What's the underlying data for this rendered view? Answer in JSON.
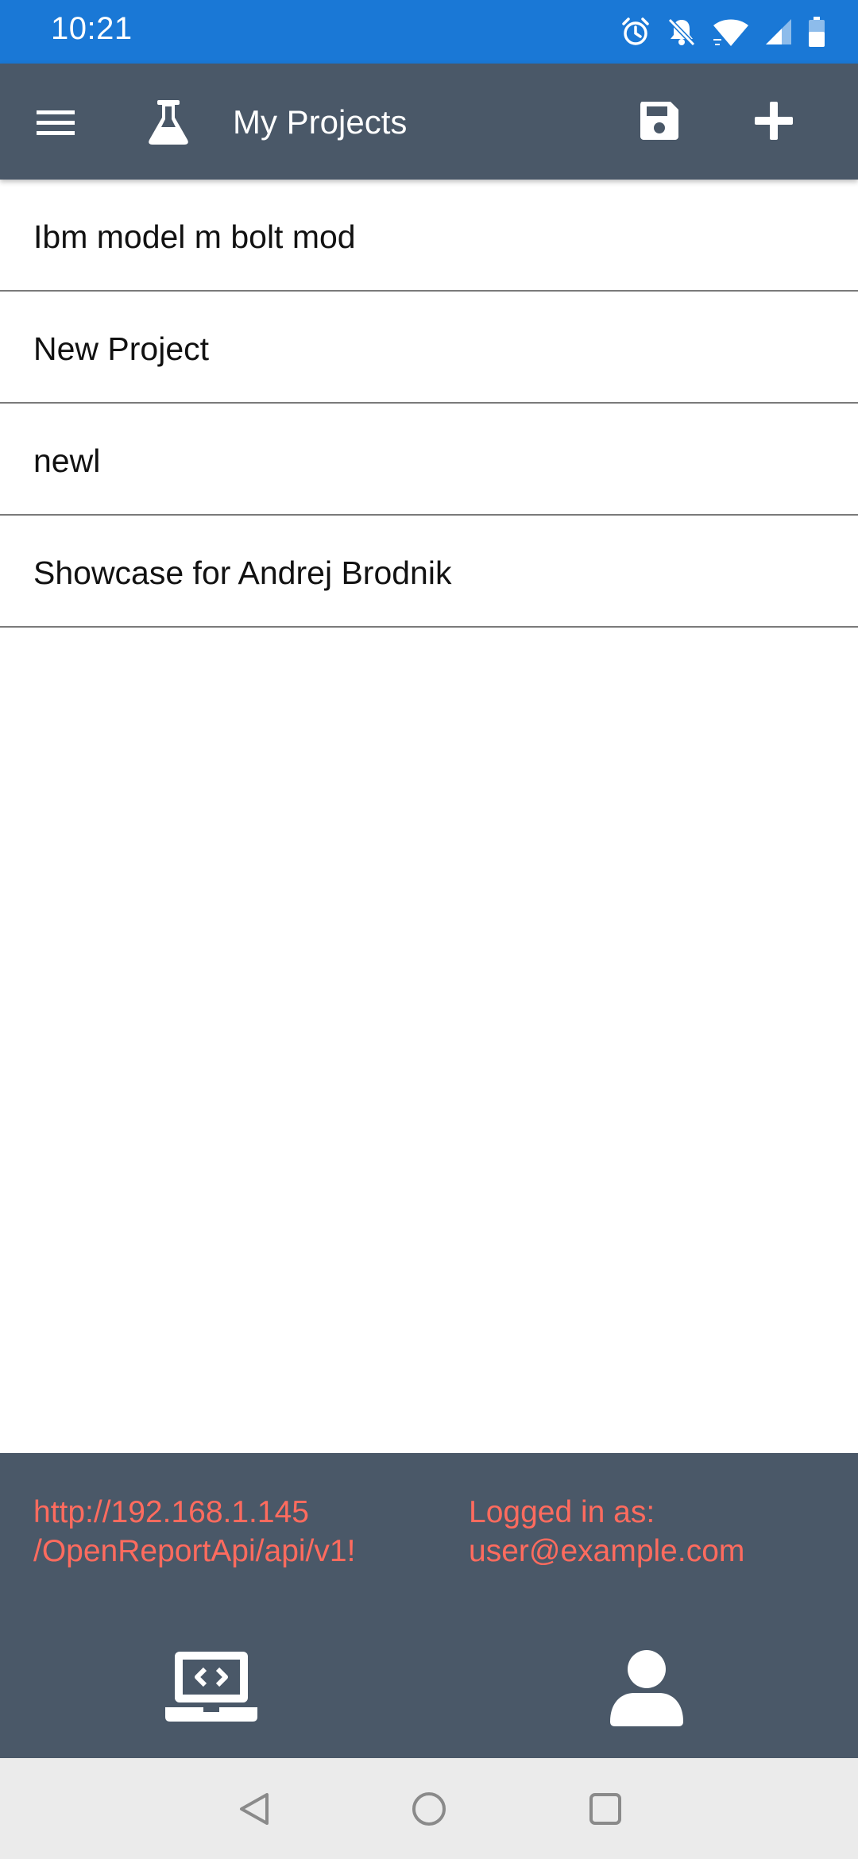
{
  "status_bar": {
    "time": "10:21",
    "icons": [
      "alarm-icon",
      "notifications-off-icon",
      "wifi-icon",
      "cellular-signal-icon",
      "battery-icon"
    ]
  },
  "app_bar": {
    "title": "My Projects",
    "icons": [
      "menu-icon",
      "flask-icon",
      "save-icon",
      "add-icon"
    ]
  },
  "projects": [
    {
      "name": "Ibm model m bolt mod"
    },
    {
      "name": "New Project"
    },
    {
      "name": "newl"
    },
    {
      "name": "Showcase for Andrej Brodnik"
    }
  ],
  "footer": {
    "server_url": "http://192.168.1.145\n/OpenReportApi/api/v1!",
    "logged_in_label": "Logged in as:",
    "logged_in_user": "user@example.com",
    "icons": [
      "laptop-code-icon",
      "user-icon"
    ]
  },
  "nav_bar": {
    "icons": [
      "back-icon",
      "home-icon",
      "recents-icon"
    ]
  },
  "colors": {
    "status_bar": "#1a78d6",
    "app_bar": "#4a5868",
    "footer_text": "#ff6b5e",
    "nav_bar": "#ebebeb"
  }
}
